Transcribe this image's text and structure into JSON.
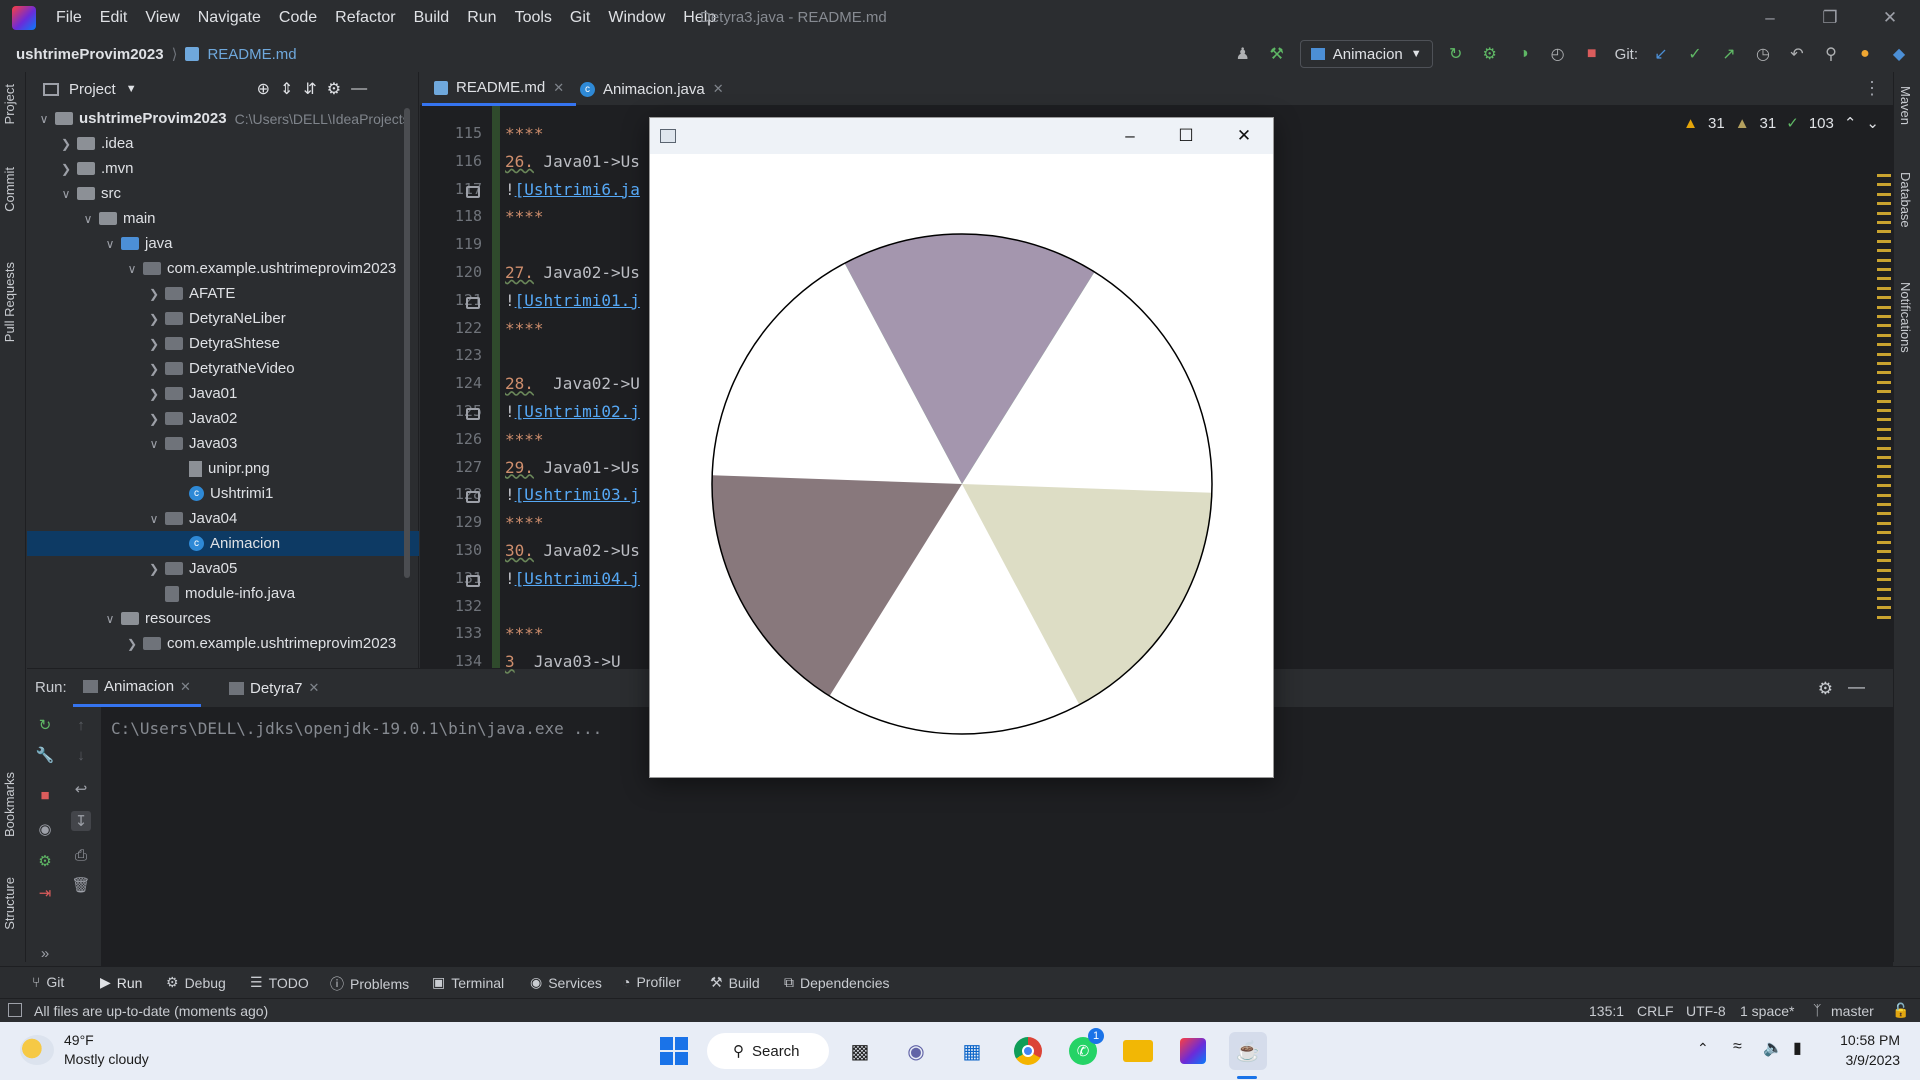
{
  "titlebar": {
    "menus": [
      "File",
      "Edit",
      "View",
      "Navigate",
      "Code",
      "Refactor",
      "Build",
      "Run",
      "Tools",
      "Git",
      "Window",
      "Help"
    ],
    "doc_title": "Detyra3.java - README.md"
  },
  "navbar": {
    "project": "ushtrimeProvim2023",
    "file": "README.md",
    "run_config": "Animacion",
    "git_label": "Git:"
  },
  "project_pane": {
    "title": "Project",
    "tree": [
      {
        "label": "ushtrimeProvim2023",
        "hint": "C:\\Users\\DELL\\IdeaProjects",
        "depth": 0,
        "kind": "module",
        "open": true
      },
      {
        "label": ".idea",
        "depth": 1,
        "kind": "folder",
        "open": false
      },
      {
        "label": ".mvn",
        "depth": 1,
        "kind": "folder",
        "open": false
      },
      {
        "label": "src",
        "depth": 1,
        "kind": "folder",
        "open": true
      },
      {
        "label": "main",
        "depth": 2,
        "kind": "folder",
        "open": true
      },
      {
        "label": "java",
        "depth": 3,
        "kind": "src",
        "open": true
      },
      {
        "label": "com.example.ushtrimeprovim2023",
        "depth": 4,
        "kind": "pkg",
        "open": true
      },
      {
        "label": "AFATE",
        "depth": 5,
        "kind": "pkg",
        "open": false
      },
      {
        "label": "DetyraNeLiber",
        "depth": 5,
        "kind": "pkg",
        "open": false
      },
      {
        "label": "DetyraShtese",
        "depth": 5,
        "kind": "pkg",
        "open": false
      },
      {
        "label": "DetyratNeVideo",
        "depth": 5,
        "kind": "pkg",
        "open": false
      },
      {
        "label": "Java01",
        "depth": 5,
        "kind": "pkg",
        "open": false
      },
      {
        "label": "Java02",
        "depth": 5,
        "kind": "pkg",
        "open": false
      },
      {
        "label": "Java03",
        "depth": 5,
        "kind": "pkg",
        "open": true
      },
      {
        "label": "unipr.png",
        "depth": 6,
        "kind": "png"
      },
      {
        "label": "Ushtrimi1",
        "depth": 6,
        "kind": "class"
      },
      {
        "label": "Java04",
        "depth": 5,
        "kind": "pkg",
        "open": true
      },
      {
        "label": "Animacion",
        "depth": 6,
        "kind": "class",
        "selected": true
      },
      {
        "label": "Java05",
        "depth": 5,
        "kind": "pkg",
        "open": false
      },
      {
        "label": "module-info.java",
        "depth": 5,
        "kind": "javafile"
      },
      {
        "label": "resources",
        "depth": 3,
        "kind": "folder",
        "open": true
      },
      {
        "label": "com.example.ushtrimeprovim2023",
        "depth": 4,
        "kind": "pkg",
        "open": false
      }
    ]
  },
  "editor": {
    "tabs": [
      "README.md",
      "Animacion.java"
    ],
    "line_numbers": [
      "115",
      "116",
      "117",
      "118",
      "119",
      "120",
      "121",
      "122",
      "123",
      "124",
      "125",
      "126",
      "127",
      "128",
      "129",
      "130",
      "131",
      "132",
      "133",
      "134"
    ],
    "lines": [
      {
        "num": "****",
        "rest": ""
      },
      {
        "num": "26.",
        "rest": " Java01->Us"
      },
      {
        "num": "!",
        "rest": "[Ushtrimi6.ja"
      },
      {
        "num": "****",
        "rest": ""
      },
      {
        "num": "",
        "rest": ""
      },
      {
        "num": "27.",
        "rest": " Java02->Us"
      },
      {
        "num": "!",
        "rest": "[Ushtrimi01.j"
      },
      {
        "num": "****",
        "rest": ""
      },
      {
        "num": "",
        "rest": ""
      },
      {
        "num": "28.",
        "rest": "  Java02->U"
      },
      {
        "num": "!",
        "rest": "[Ushtrimi02.j"
      },
      {
        "num": "****",
        "rest": ""
      },
      {
        "num": "29.",
        "rest": " Java01->Us"
      },
      {
        "num": "!",
        "rest": "[Ushtrimi03.j"
      },
      {
        "num": "****",
        "rest": ""
      },
      {
        "num": "30.",
        "rest": " Java02->Us"
      },
      {
        "num": "!",
        "rest": "[Ushtrimi04.j"
      },
      {
        "num": "",
        "rest": ""
      },
      {
        "num": "****",
        "rest": ""
      },
      {
        "num": "3",
        "rest": "  Java03->U"
      }
    ],
    "inspections": {
      "warnings_a": "31",
      "warnings_b": "31",
      "ok": "103"
    }
  },
  "swing_window": {
    "wedges": [
      {
        "from_deg": -118,
        "to_deg": -58,
        "color": "#7ae68c"
      },
      {
        "from_deg": 2,
        "to_deg": 62,
        "color": "#ddddc5"
      },
      {
        "from_deg": 122,
        "to_deg": 182,
        "color": "#88787c"
      },
      {
        "from_deg": 242,
        "to_deg": 302,
        "color": "#a496ae"
      }
    ]
  },
  "run_panel": {
    "label": "Run:",
    "tabs": [
      "Animacion",
      "Detyra7"
    ],
    "console": "C:\\Users\\DELL\\.jdks\\openjdk-19.0.1\\bin\\java.exe ..."
  },
  "tool_tabs": [
    "Git",
    "Run",
    "Debug",
    "TODO",
    "Problems",
    "Terminal",
    "Services",
    "Profiler",
    "Build",
    "Dependencies"
  ],
  "left_strip": [
    "Project",
    "Commit",
    "Pull Requests",
    "Bookmarks",
    "Structure"
  ],
  "right_strip": [
    "Maven",
    "Database",
    "Notifications"
  ],
  "statusbar": {
    "message": "All files are up-to-date (moments ago)",
    "position": "135:1",
    "line_sep": "CRLF",
    "encoding": "UTF-8",
    "indent": "1 space*",
    "branch": "master"
  },
  "taskbar": {
    "temp": "49°F",
    "weather": "Mostly cloudy",
    "search": "Search",
    "time": "10:58 PM",
    "date": "3/9/2023",
    "whatsapp_badge": "1"
  }
}
